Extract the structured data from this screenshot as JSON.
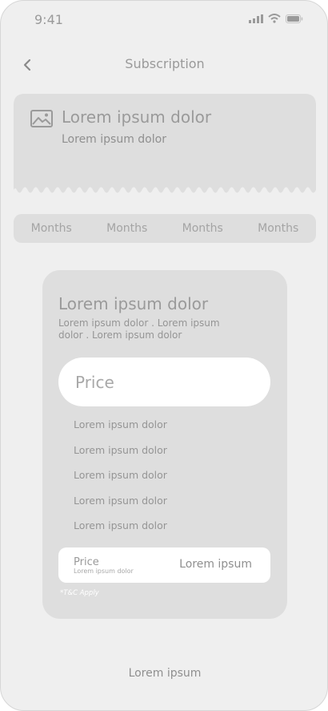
{
  "status_bar": {
    "time": "9:41"
  },
  "header": {
    "title": "Subscription",
    "back_icon": "chevron-left-icon"
  },
  "banner": {
    "icon": "image-icon",
    "title": "Lorem ipsum dolor",
    "subtitle": "Lorem ipsum dolor"
  },
  "tabs": [
    {
      "label": "Months"
    },
    {
      "label": "Months"
    },
    {
      "label": "Months"
    },
    {
      "label": "Months"
    }
  ],
  "plan_card": {
    "title": "Lorem ipsum dolor",
    "description": "Lorem ipsum dolor . Lorem ipsum dolor . Lorem ipsum dolor",
    "price_label": "Price",
    "features": [
      "Lorem ipsum dolor",
      "Lorem ipsum dolor",
      "Lorem ipsum dolor",
      "Lorem ipsum dolor",
      "Lorem ipsum dolor"
    ],
    "summary": {
      "price": "Price",
      "price_sub": "Lorem ipsum dolor",
      "action": "Lorem ipsum"
    },
    "terms": "*T&C Apply"
  },
  "footer": {
    "label": "Lorem ipsum"
  },
  "colors": {
    "background": "#efefef",
    "card": "#dedede",
    "pill": "#ffffff"
  }
}
